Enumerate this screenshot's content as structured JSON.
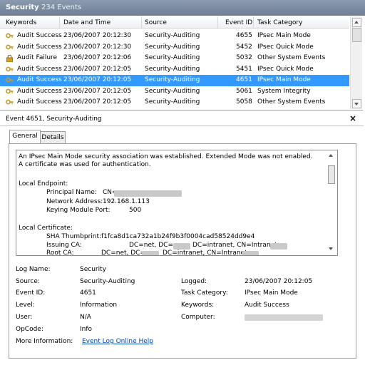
{
  "header": {
    "title": "Security",
    "count": "234 Events"
  },
  "columns": [
    "Keywords",
    "Date and Time",
    "Source",
    "Event ID",
    "Task Category"
  ],
  "events": [
    {
      "keyword": "Audit Success",
      "datetime": "23/06/2007 20:12:30",
      "source": "Security-Auditing",
      "id": "4655",
      "category": "IPsec Main Mode",
      "icon": "key-icon"
    },
    {
      "keyword": "Audit Success",
      "datetime": "23/06/2007 20:12:30",
      "source": "Security-Auditing",
      "id": "5452",
      "category": "IPsec Quick Mode",
      "icon": "key-icon"
    },
    {
      "keyword": "Audit Failure",
      "datetime": "23/06/2007 20:12:06",
      "source": "Security-Auditing",
      "id": "5032",
      "category": "Other System Events",
      "icon": "lock-icon"
    },
    {
      "keyword": "Audit Success",
      "datetime": "23/06/2007 20:12:05",
      "source": "Security-Auditing",
      "id": "5451",
      "category": "IPsec Quick Mode",
      "icon": "key-icon"
    },
    {
      "keyword": "Audit Success",
      "datetime": "23/06/2007 20:12:05",
      "source": "Security-Auditing",
      "id": "4651",
      "category": "IPsec Main Mode",
      "icon": "key-icon",
      "selected": true
    },
    {
      "keyword": "Audit Success",
      "datetime": "23/06/2007 20:12:05",
      "source": "Security-Auditing",
      "id": "5061",
      "category": "System Integrity",
      "icon": "key-icon"
    },
    {
      "keyword": "Audit Success",
      "datetime": "23/06/2007 20:12:05",
      "source": "Security-Auditing",
      "id": "5058",
      "category": "Other System Events",
      "icon": "key-icon"
    }
  ],
  "details": {
    "title": "Event 4651, Security-Auditing",
    "close": "×",
    "tabs": [
      "General",
      "Details"
    ],
    "description": {
      "intro": "An IPsec Main Mode security association was established. Extended Mode was not enabled.  A certificate was used for authentication.",
      "local_endpoint_header": "Local Endpoint:",
      "principal_name_label": "Principal Name:",
      "principal_name_value": "CN=",
      "network_address_label": "Network Address:",
      "network_address_value": "192.168.1.113",
      "keying_port_label": "Keying Module Port:",
      "keying_port_value": "500",
      "local_cert_header": "Local Certificate:",
      "sha_label": "SHA Thumbprint:",
      "sha_value": "f1fca8d1ca732a1b24f9b3f0004cad58524dd9e4",
      "issuing_ca_label": "Issuing CA:",
      "issuing_ca_dc1": "DC=net, DC=",
      "issuing_ca_dc2": "DC=intranet, CN=Intranet",
      "root_ca_label": "Root CA:",
      "root_ca_dc1": "DC=net, DC=",
      "root_ca_dc2": "DC=intranet, CN=Intranet"
    },
    "props": {
      "log_name_label": "Log Name:",
      "log_name": "Security",
      "source_label": "Source:",
      "source": "Security-Auditing",
      "logged_label": "Logged:",
      "logged": "23/06/2007 20:12:05",
      "event_id_label": "Event ID:",
      "event_id": "4651",
      "task_category_label": "Task Category:",
      "task_category": "IPsec Main Mode",
      "level_label": "Level:",
      "level": "Information",
      "keywords_label": "Keywords:",
      "keywords": "Audit Success",
      "user_label": "User:",
      "user": "N/A",
      "computer_label": "Computer:",
      "opcode_label": "OpCode:",
      "opcode": "Info",
      "more_info_label": "More Information:",
      "more_info_link": "Event Log Online Help"
    }
  },
  "colors": {
    "selection": "#3399ff",
    "titlebar": "#7a8aa0",
    "link": "#0645ad"
  }
}
